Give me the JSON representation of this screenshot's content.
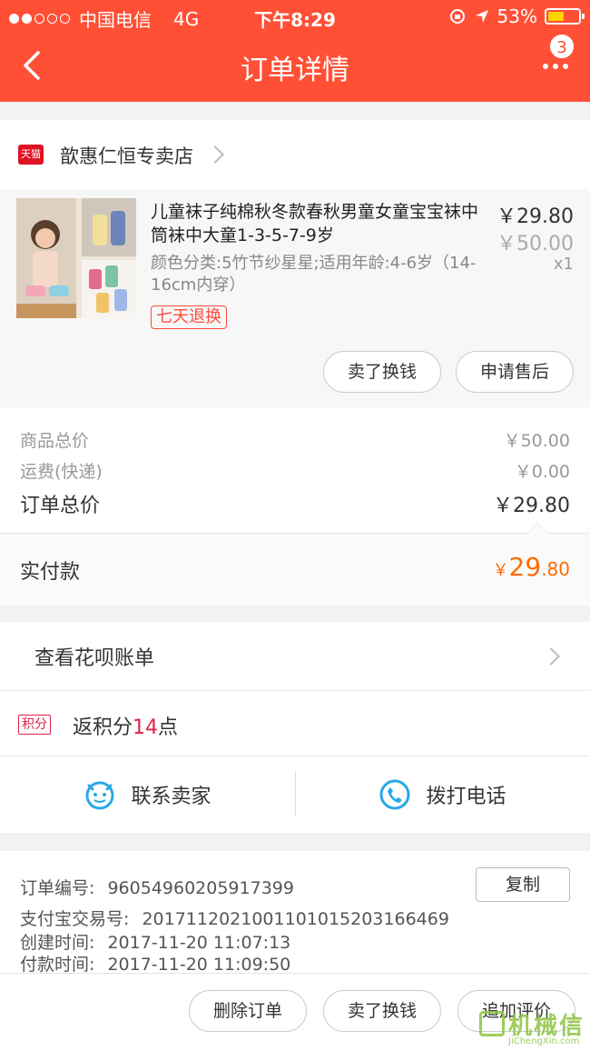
{
  "status_bar": {
    "carrier": "中国电信",
    "network": "4G",
    "time": "下午8:29",
    "battery": "53%",
    "battery_level": 0.53
  },
  "nav": {
    "title": "订单详情",
    "badge_count": "3",
    "back_icon": "chevron-left-icon",
    "more_icon": "more-dots-icon"
  },
  "shop": {
    "platform_tag": "天猫",
    "name": "歆惠仁恒专卖店"
  },
  "product": {
    "title": "儿童袜子纯棉秋冬款春秋男童女童宝宝袜中筒袜中大童1-3-5-7-9岁",
    "spec": "颜色分类:5竹节纱星星;适用年龄:4-6岁（14-16cm内穿）",
    "return_tag": "七天退换",
    "price": "￥29.80",
    "original_price": "￥50.00",
    "quantity": "x1",
    "actions": [
      "卖了换钱",
      "申请售后"
    ]
  },
  "summary": {
    "rows": [
      {
        "label": "商品总价",
        "value": "￥50.00"
      },
      {
        "label": "运费(快递)",
        "value": "￥0.00"
      }
    ],
    "total_label": "订单总价",
    "total_value": "￥29.80",
    "paid_label": "实付款",
    "paid_currency": "￥",
    "paid_int": "29",
    "paid_dec": ".80"
  },
  "huabei": {
    "label": "查看花呗账单"
  },
  "points": {
    "tag": "积分",
    "prefix": "返积分",
    "number": "14",
    "suffix": "点"
  },
  "contact": {
    "seller": "联系卖家",
    "phone": "拨打电话"
  },
  "order_info": {
    "order_no_label": "订单编号:",
    "order_no": "96054960205917399",
    "copy": "复制",
    "alipay_label": "支付宝交易号:",
    "alipay_no": "2017112021001101015203166469",
    "created_label": "创建时间:",
    "created": "2017-11-20 11:07:13",
    "paid_label": "付款时间:",
    "paid": "2017-11-20 11:09:50"
  },
  "bottom_actions": [
    "删除订单",
    "卖了换钱",
    "追加评价"
  ],
  "watermark": {
    "text": "机械信",
    "sub": "JiChengXin.com"
  },
  "colors": {
    "header": "#ff5036",
    "accent_orange": "#ff6a00",
    "points_red": "#e0204a",
    "contact_blue": "#2aa7e8"
  }
}
